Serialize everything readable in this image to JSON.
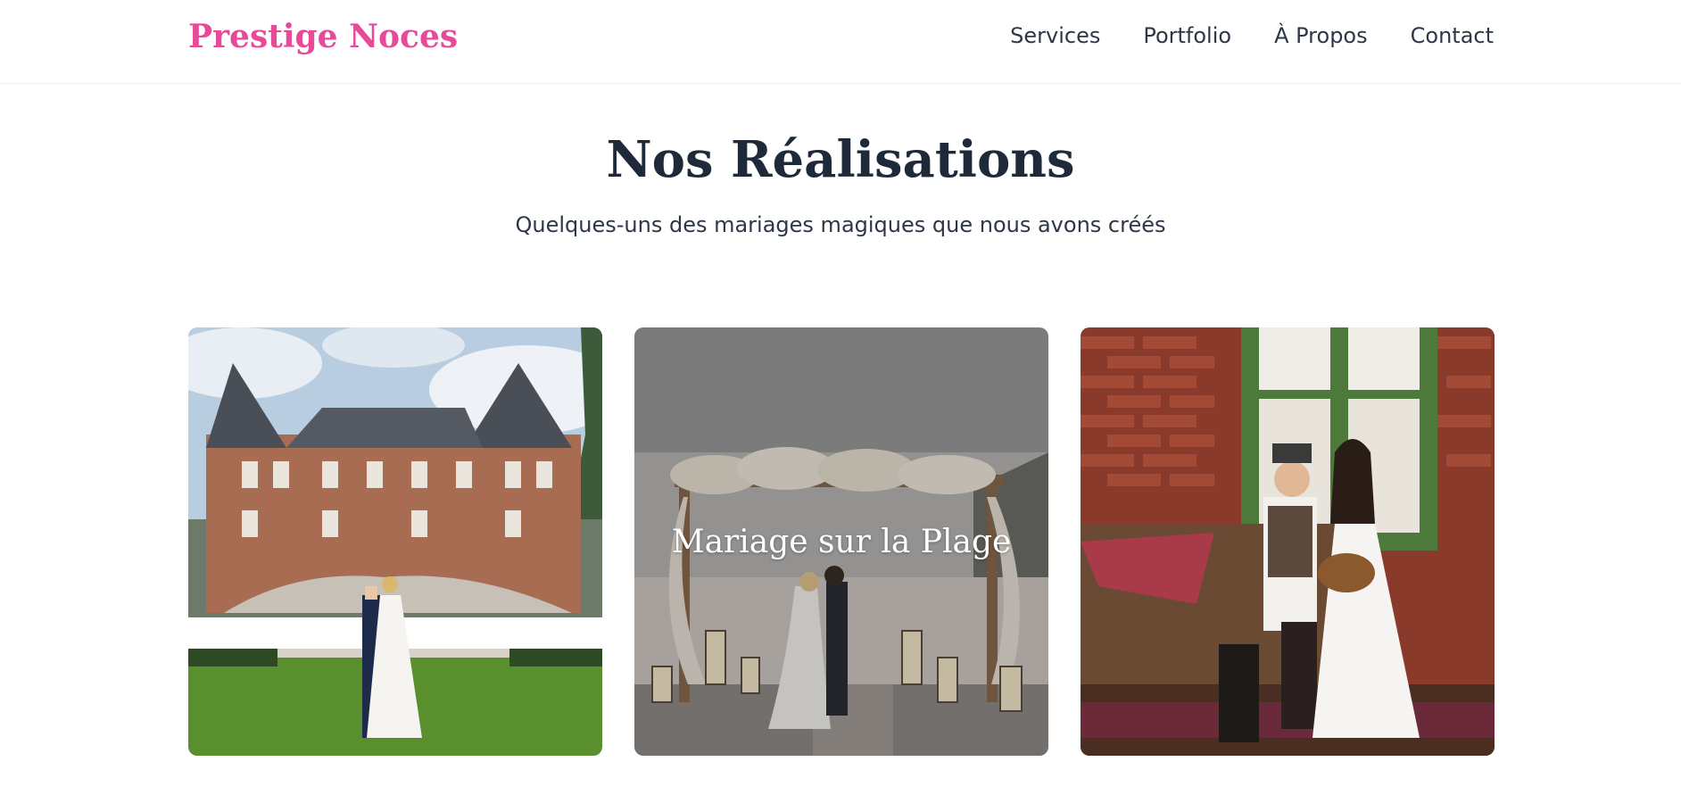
{
  "brand": {
    "name": "Prestige Noces",
    "color": "#e84a9a"
  },
  "nav": {
    "items": [
      {
        "label": "Services"
      },
      {
        "label": "Portfolio"
      },
      {
        "label": "À Propos"
      },
      {
        "label": "Contact"
      }
    ]
  },
  "portfolio": {
    "title": "Nos Réalisations",
    "subtitle": "Quelques-uns des mariages magiques que nous avons créés",
    "cards": [
      {
        "image": "chateau-wedding-photo"
      },
      {
        "image": "beach-wedding-photo",
        "overlay_title": "Mariage sur la Plage"
      },
      {
        "image": "rustic-wedding-photo"
      }
    ]
  }
}
